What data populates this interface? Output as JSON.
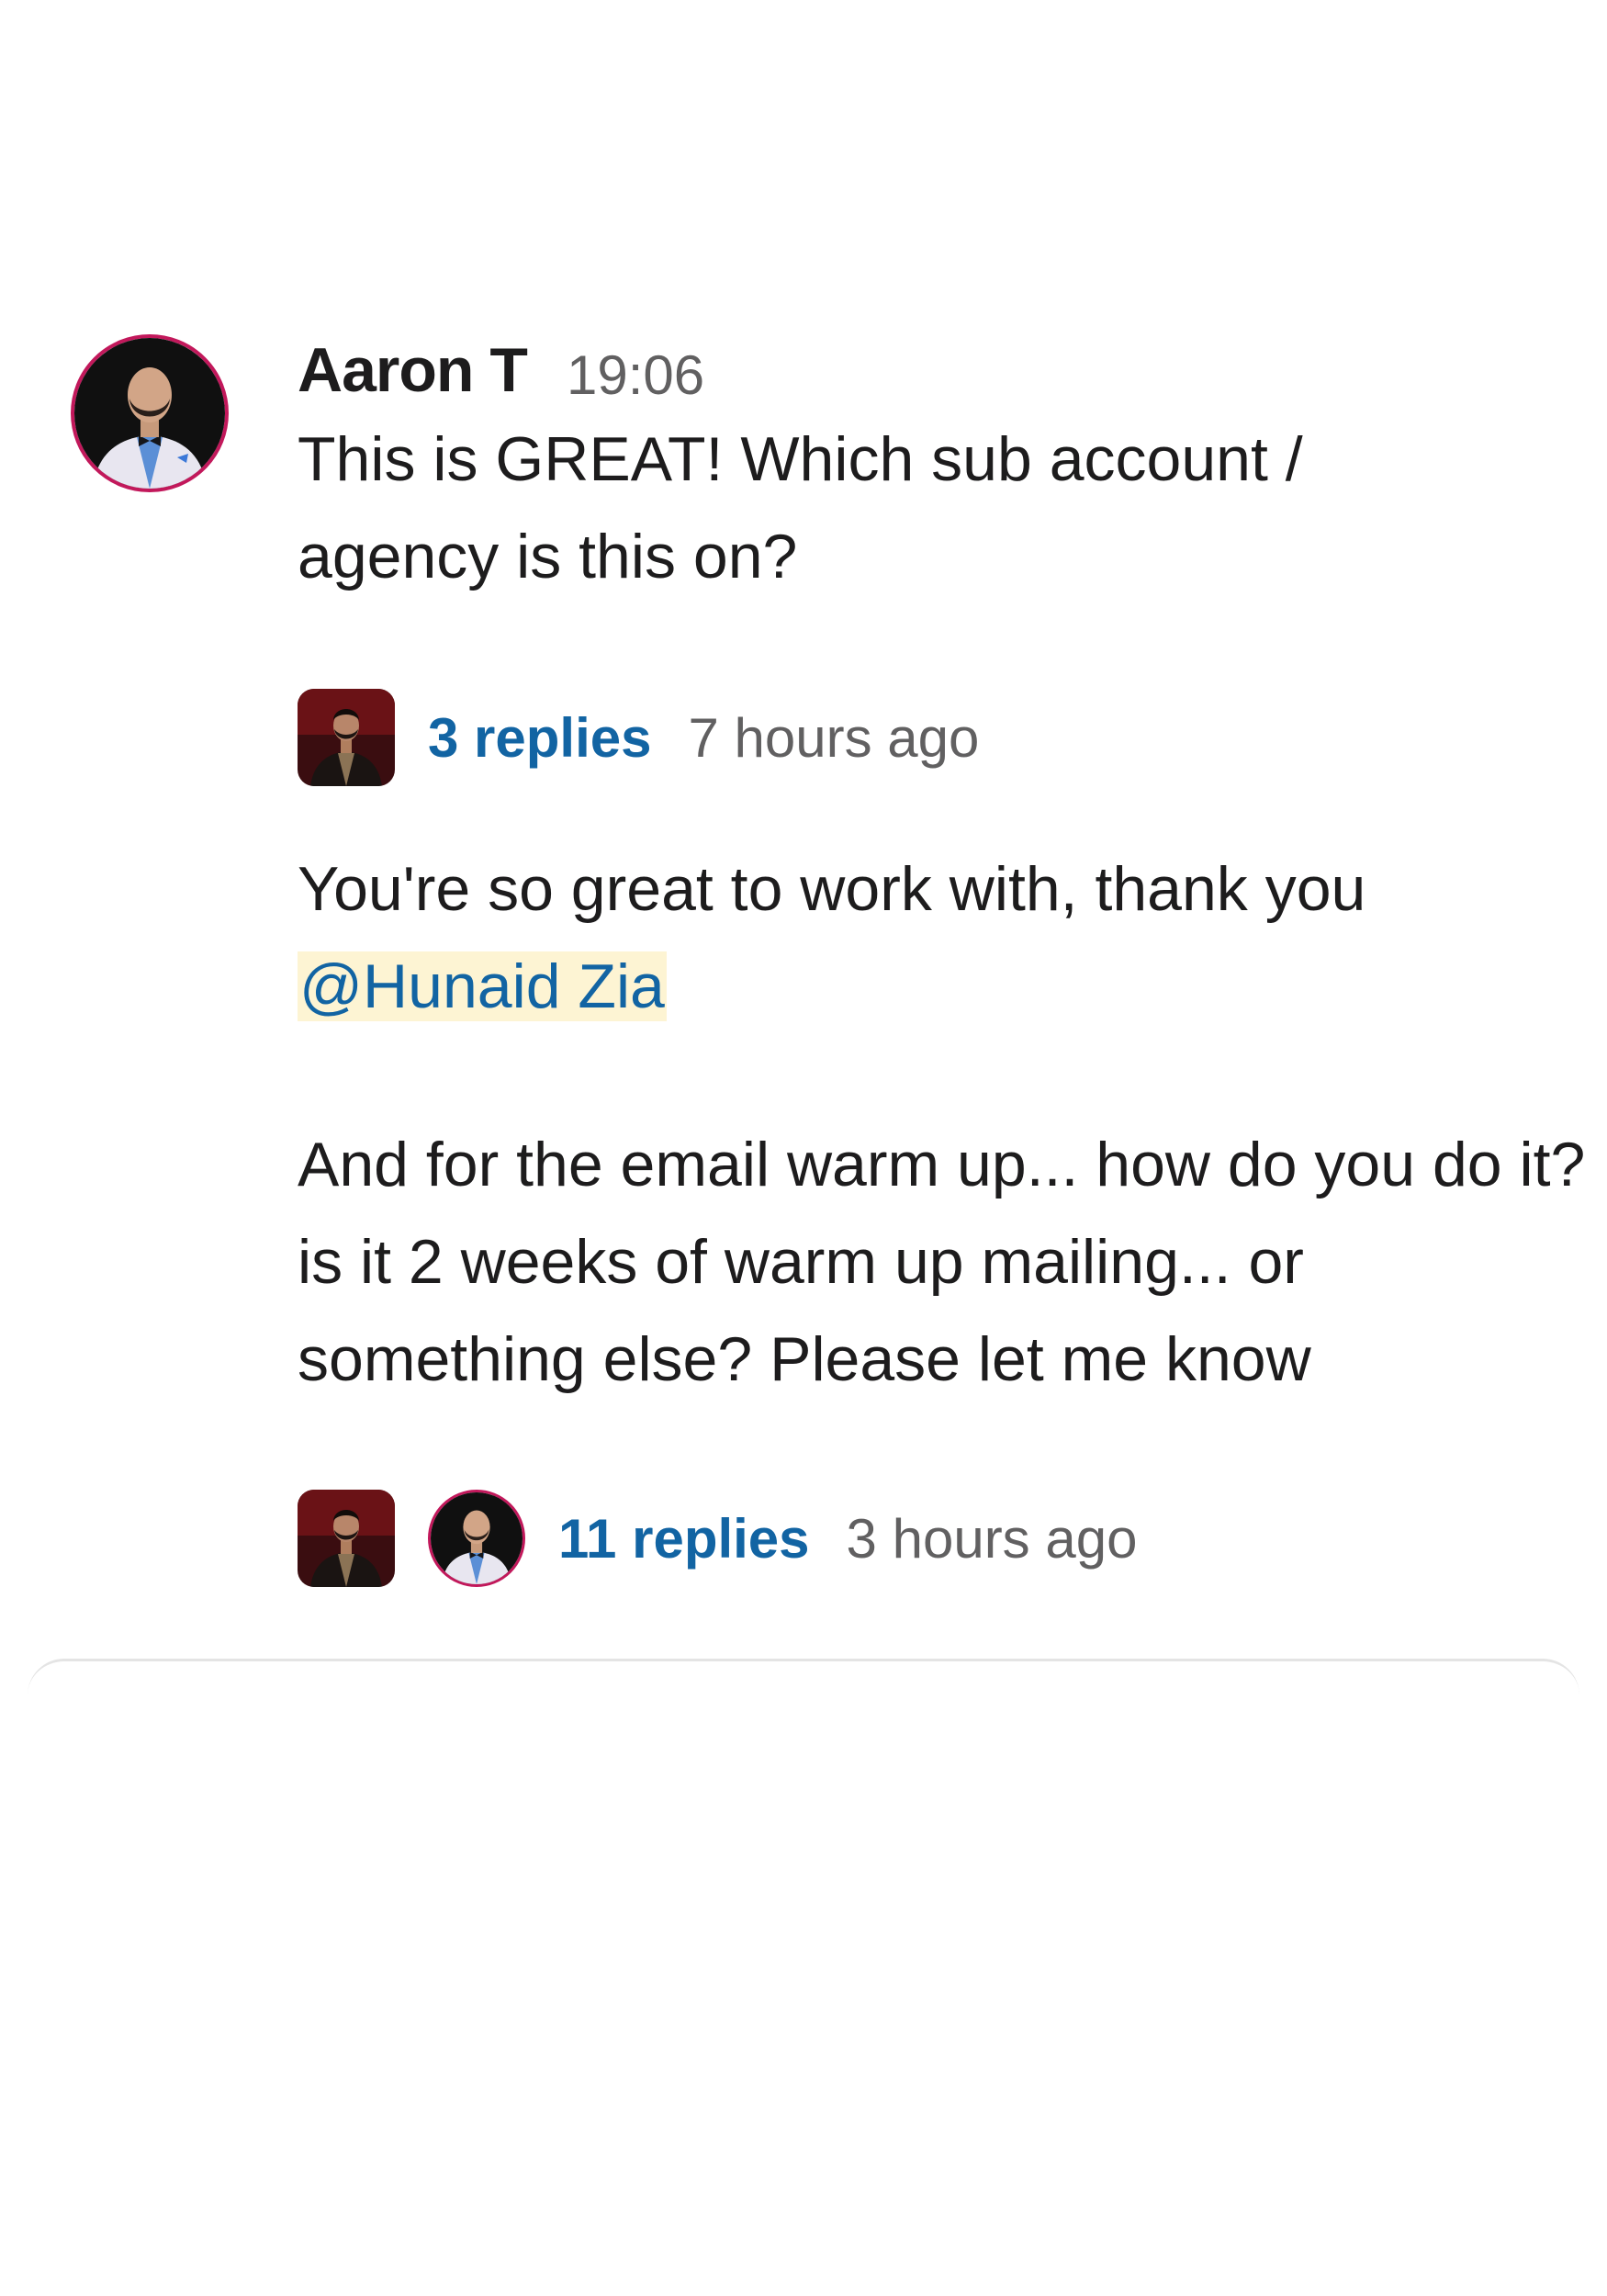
{
  "message": {
    "author": "Aaron T",
    "time": "19:06",
    "paragraphs": {
      "p1": "This is GREAT! Which sub account / agency is this on?",
      "p2_text": "You're so great to work with, thank you ",
      "p2_mention": "@Hunaid Zia",
      "p3": "And for the email warm up... how do you do it? is it 2 weeks of warm up mailing... or something else? Please let me know"
    }
  },
  "threads": [
    {
      "replies": "3 replies",
      "ago": "7 hours ago"
    },
    {
      "replies": "11 replies",
      "ago": "3 hours ago"
    }
  ],
  "colors": {
    "link": "#1264a3",
    "mention_bg": "#fdf4d3",
    "muted": "#616061",
    "avatar_ring": "#c2185b"
  },
  "icons": {
    "author_avatar": "person-avatar-icon",
    "replier_avatar": "person-avatar-icon"
  }
}
